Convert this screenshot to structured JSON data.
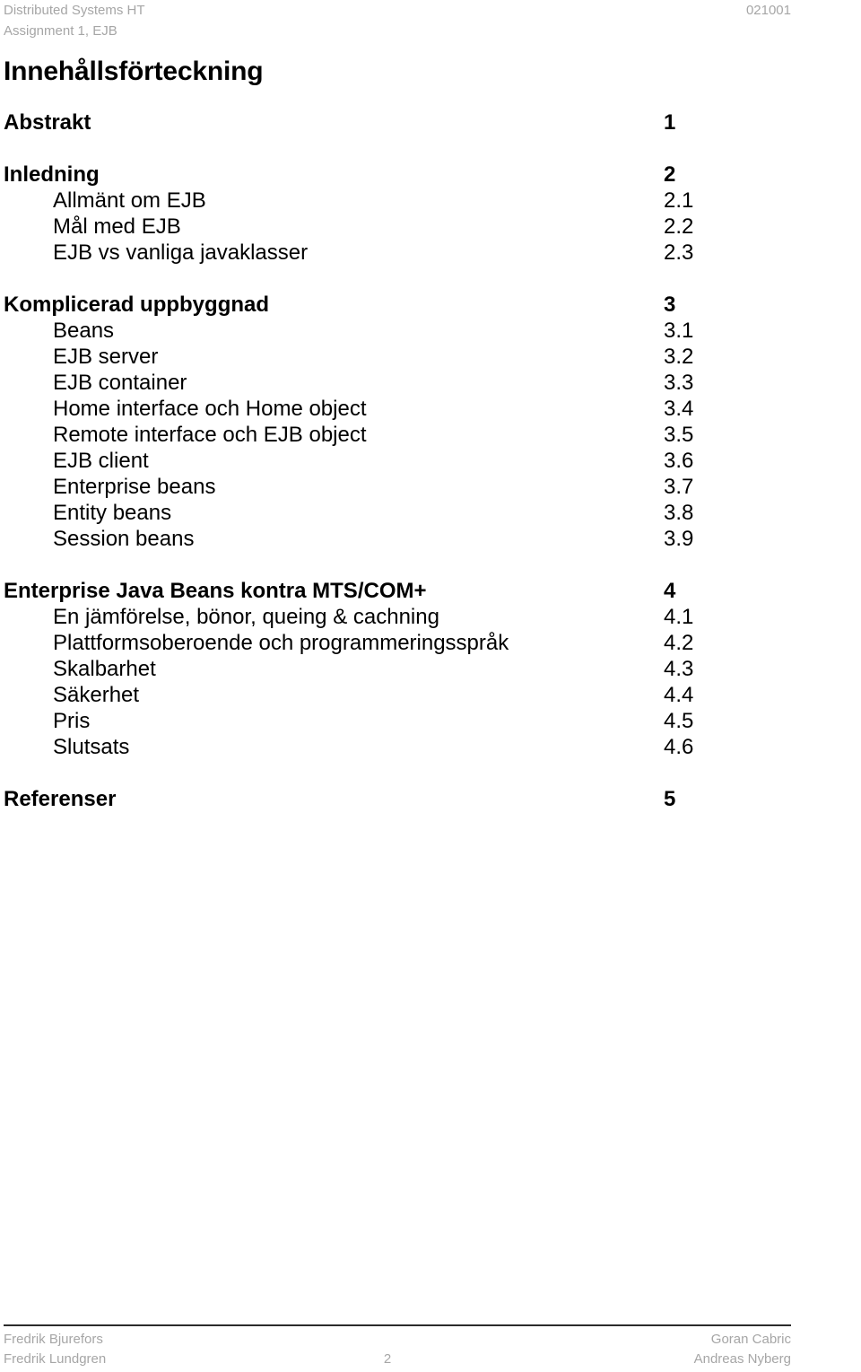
{
  "header": {
    "left_line_1": "Distributed Systems HT",
    "left_line_2": "Assignment 1, EJB",
    "right": "021001"
  },
  "document": {
    "toc_title": "Innehållsförteckning"
  },
  "toc": {
    "groups": [
      {
        "entries": [
          {
            "level": 1,
            "label": "Abstrakt",
            "page": "1"
          }
        ]
      },
      {
        "entries": [
          {
            "level": 1,
            "label": "Inledning",
            "page": "2"
          },
          {
            "level": 2,
            "label": "Allmänt om EJB",
            "page": "2.1"
          },
          {
            "level": 2,
            "label": "Mål med EJB",
            "page": "2.2"
          },
          {
            "level": 2,
            "label": "EJB vs vanliga javaklasser",
            "page": "2.3"
          }
        ]
      },
      {
        "entries": [
          {
            "level": 1,
            "label": "Komplicerad uppbyggnad",
            "page": "3"
          },
          {
            "level": 2,
            "label": "Beans",
            "page": "3.1"
          },
          {
            "level": 2,
            "label": "EJB server",
            "page": "3.2"
          },
          {
            "level": 2,
            "label": "EJB container",
            "page": "3.3"
          },
          {
            "level": 2,
            "label": "Home interface och Home object",
            "page": "3.4"
          },
          {
            "level": 2,
            "label": "Remote interface och EJB object",
            "page": "3.5"
          },
          {
            "level": 2,
            "label": "EJB client",
            "page": "3.6"
          },
          {
            "level": 2,
            "label": "Enterprise beans",
            "page": "3.7"
          },
          {
            "level": 2,
            "label": "Entity beans",
            "page": "3.8"
          },
          {
            "level": 2,
            "label": "Session beans",
            "page": "3.9"
          }
        ]
      },
      {
        "entries": [
          {
            "level": 1,
            "label": "Enterprise Java Beans kontra MTS/COM+",
            "page": "4"
          },
          {
            "level": 2,
            "label": "En jämförelse, bönor, queing & cachning",
            "page": "4.1"
          },
          {
            "level": 2,
            "label": "Plattformsoberoende och programmeringsspråk",
            "page": "4.2"
          },
          {
            "level": 2,
            "label": "Skalbarhet",
            "page": "4.3"
          },
          {
            "level": 2,
            "label": "Säkerhet",
            "page": "4.4"
          },
          {
            "level": 2,
            "label": "Pris",
            "page": "4.5"
          },
          {
            "level": 2,
            "label": "Slutsats",
            "page": "4.6"
          }
        ]
      },
      {
        "entries": [
          {
            "level": 1,
            "label": "Referenser",
            "page": "5"
          }
        ]
      }
    ]
  },
  "footer": {
    "left_line_1": "Fredrik Bjurefors",
    "left_line_2": "Fredrik Lundgren",
    "page_number": "2",
    "right_line_1": "Goran Cabric",
    "right_line_2": "Andreas Nyberg"
  },
  "colors": {
    "text": "#000000",
    "muted": "#a6a6a6",
    "rule": "#2b2b2b",
    "background": "#ffffff"
  }
}
